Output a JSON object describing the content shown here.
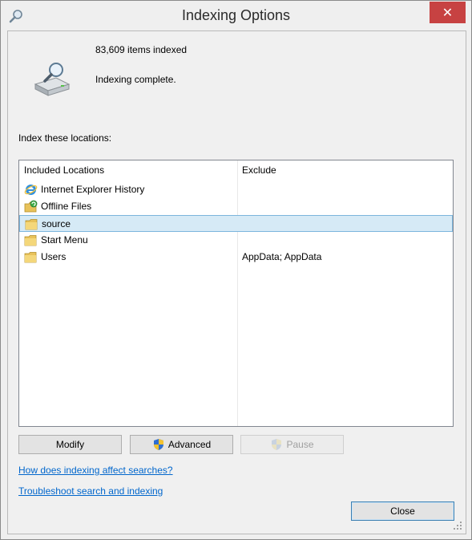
{
  "window": {
    "title": "Indexing Options",
    "close_glyph": "✕"
  },
  "summary": {
    "items_indexed": "83,609 items indexed",
    "status": "Indexing complete."
  },
  "locations": {
    "section_label": "Index these locations:",
    "col_included": "Included Locations",
    "col_exclude": "Exclude",
    "rows": [
      {
        "name": "Internet Explorer History",
        "exclude": "",
        "icon": "ie-icon"
      },
      {
        "name": "Offline Files",
        "exclude": "",
        "icon": "offline-files-icon"
      },
      {
        "name": "source",
        "exclude": "",
        "icon": "folder-icon",
        "selected": true
      },
      {
        "name": "Start Menu",
        "exclude": "",
        "icon": "folder-icon"
      },
      {
        "name": "Users",
        "exclude": "AppData; AppData",
        "icon": "folder-icon"
      }
    ]
  },
  "buttons": {
    "modify": "Modify",
    "advanced": "Advanced",
    "pause": "Pause",
    "close": "Close"
  },
  "links": {
    "how_affects": "How does indexing affect searches?",
    "troubleshoot": "Troubleshoot search and indexing"
  },
  "colors": {
    "close_button": "#c74242",
    "link": "#0066cc",
    "selection": "#d6eaf6"
  }
}
